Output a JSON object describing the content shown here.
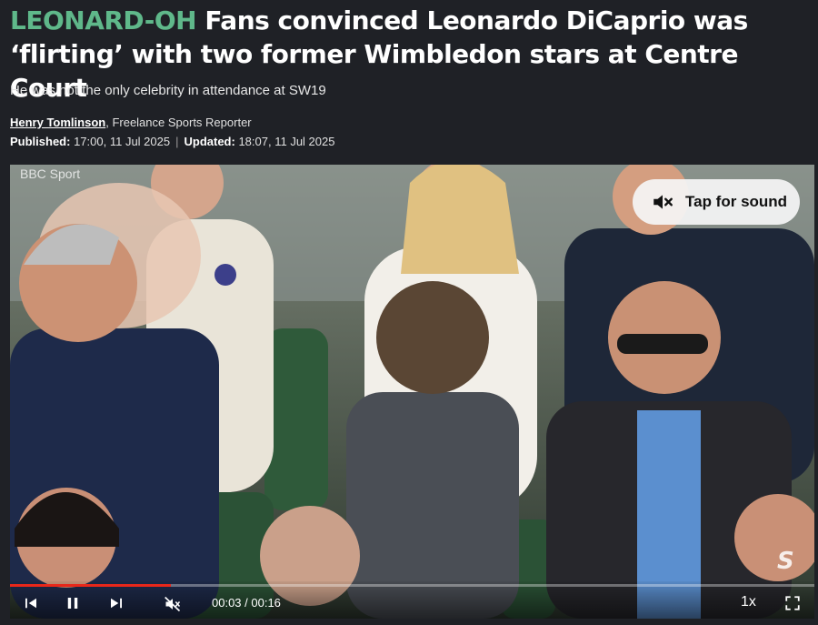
{
  "article": {
    "kicker": "LEONARD-OH",
    "headline": "Fans convinced Leonardo DiCaprio was ‘flirting’ with two former Wimbledon stars at Centre Court",
    "subheadline": "He was not the only celebrity in attendance at SW19",
    "author": "Henry Tomlinson",
    "author_role": ", Freelance Sports Reporter",
    "published_label": "Published:",
    "published_value": "17:00, 11 Jul 2025",
    "separator": "|",
    "updated_label": "Updated:",
    "updated_value": "18:07, 11 Jul 2025"
  },
  "video": {
    "watermark": "BBC Sport",
    "tap_for_sound": "Tap for sound",
    "brand_mark": "S",
    "time_display": "00:03 / 00:16",
    "progress": 0.2,
    "speed": "1x"
  },
  "colors": {
    "kicker": "#5fb88a",
    "background": "#1f2126",
    "progress": "#e8271a"
  },
  "icons": {
    "previous": "skip-previous-icon",
    "pause": "pause-icon",
    "next": "skip-next-icon",
    "mute": "mute-icon",
    "fullscreen": "fullscreen-icon"
  }
}
